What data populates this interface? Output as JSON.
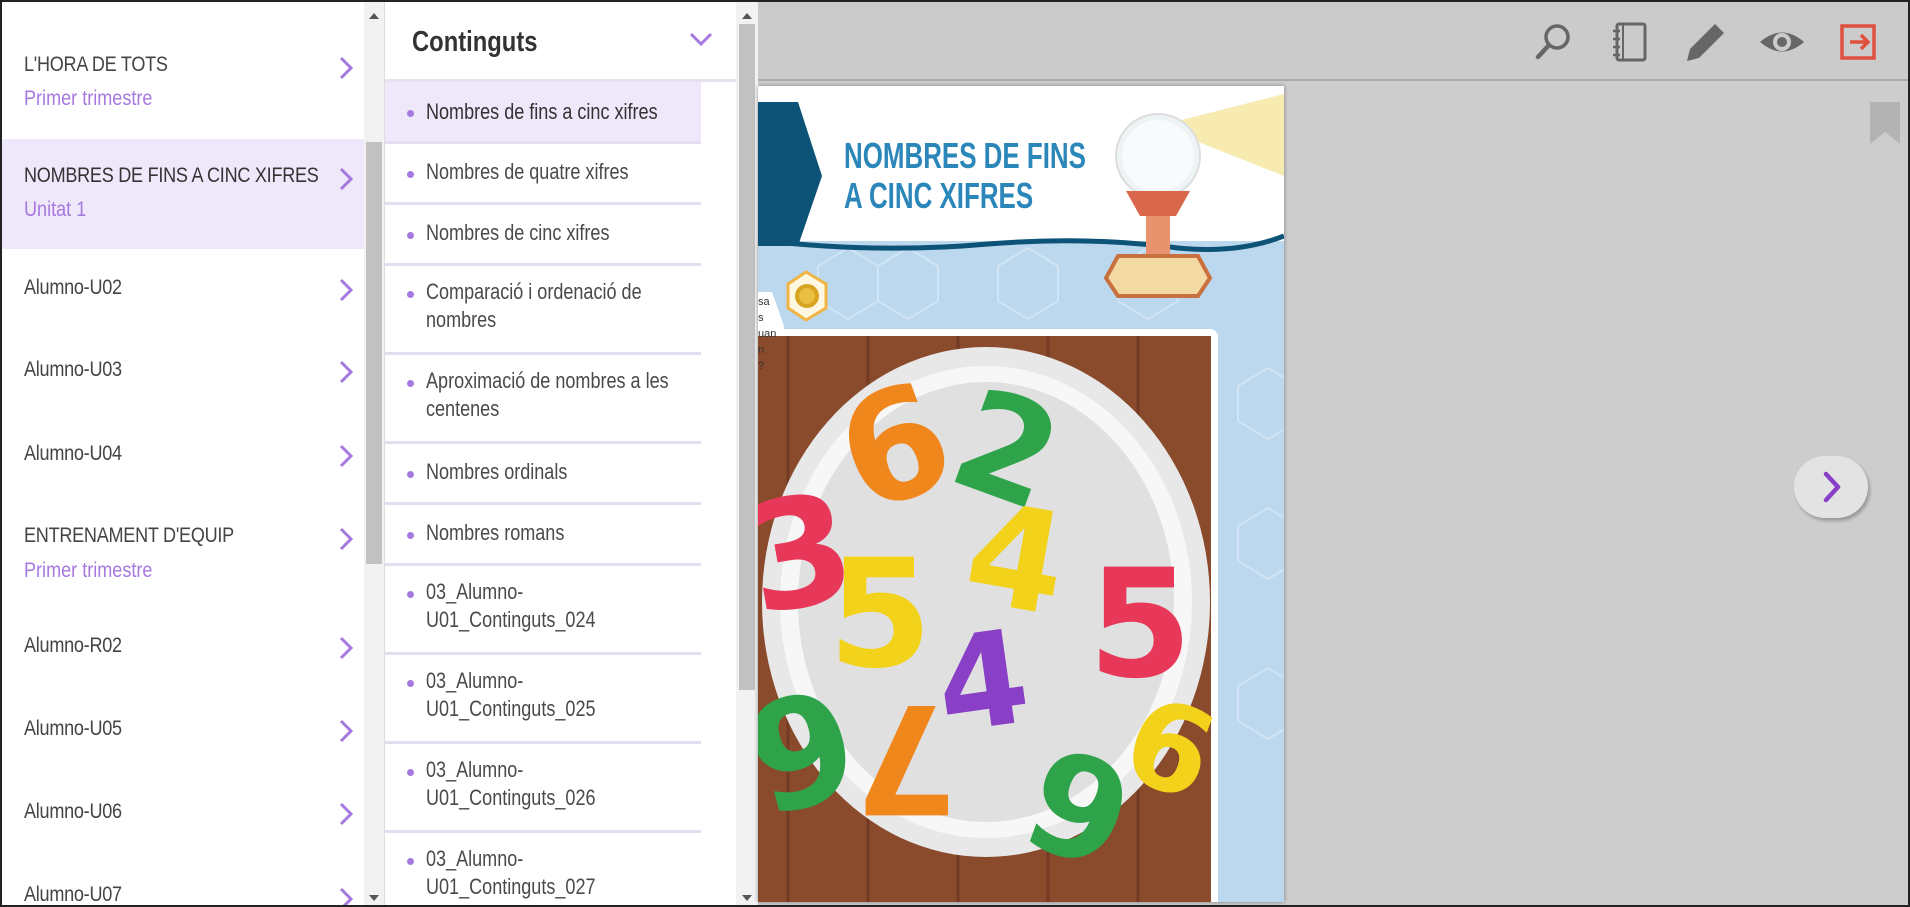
{
  "units": {
    "items": [
      {
        "title": "L'HORA DE TOTS",
        "subtitle": "Primer trimestre"
      },
      {
        "title": "NOMBRES DE FINS A CINC XIFRES",
        "subtitle": "Unitat 1"
      },
      {
        "title": "Alumno-U02",
        "subtitle": ""
      },
      {
        "title": "Alumno-U03",
        "subtitle": ""
      },
      {
        "title": "Alumno-U04",
        "subtitle": ""
      },
      {
        "title": "ENTRENAMENT D'EQUIP",
        "subtitle": "Primer trimestre"
      },
      {
        "title": "Alumno-R02",
        "subtitle": ""
      },
      {
        "title": "Alumno-U05",
        "subtitle": ""
      },
      {
        "title": "Alumno-U06",
        "subtitle": ""
      },
      {
        "title": "Alumno-U07",
        "subtitle": ""
      }
    ]
  },
  "contents": {
    "title": "Continguts",
    "items": [
      "Nombres de fins a cinc xifres",
      "Nombres de quatre xifres",
      "Nombres de cinc xifres",
      "Comparació i ordenació de nombres",
      "Aproximació de nombres a les centenes",
      "Nombres ordinals",
      "Nombres romans",
      "03_Alumno-U01_Continguts_024",
      "03_Alumno-U01_Continguts_025",
      "03_Alumno-U01_Continguts_026",
      "03_Alumno-U01_Continguts_027"
    ]
  },
  "toolbar": {
    "icons": [
      "search-icon",
      "notebook-icon",
      "pencil-icon",
      "eye-icon",
      "exit-icon"
    ]
  },
  "page": {
    "heading_line1": "NOMBRES DE FINS",
    "heading_line2": "A CINC XIFRES",
    "peek_text": [
      "sa",
      "s",
      "uan",
      "n",
      "?"
    ]
  },
  "colors": {
    "accent": "#a679e0",
    "exit": "#e0503c",
    "active_bg": "#efe7fa",
    "page_blue": "#2b86b9"
  }
}
